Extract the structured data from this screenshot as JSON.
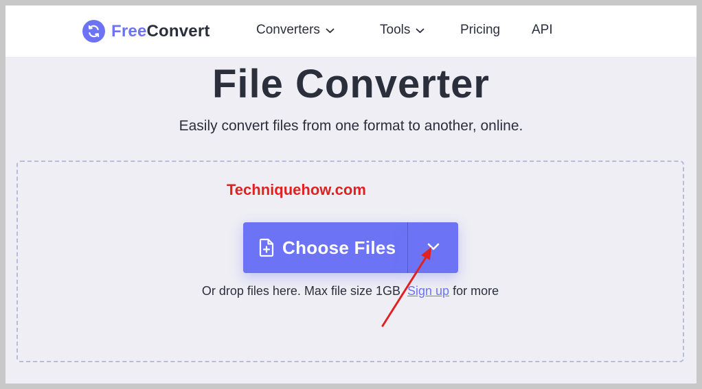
{
  "brand": {
    "name_part1": "Free",
    "name_part2": "Convert"
  },
  "nav": {
    "converters": "Converters",
    "tools": "Tools",
    "pricing": "Pricing",
    "api": "API"
  },
  "hero": {
    "title": "File Converter",
    "subtitle": "Easily convert files from one format to another, online."
  },
  "upload": {
    "watermark": "Techniquehow.com",
    "choose_label": "Choose Files",
    "hint_prefix": "Or drop files here. Max file size 1GB.",
    "hint_link": "Sign up",
    "hint_suffix": "for more"
  },
  "colors": {
    "accent": "#6c74f5",
    "text": "#2b2f3c",
    "watermark": "#e02121",
    "dropzone_bg": "#eeeef4"
  },
  "icons": {
    "logo": "refresh-circle-icon",
    "nav_chevron": "chevron-down-icon",
    "file_add": "file-plus-icon",
    "dropdown": "chevron-down-icon",
    "annotation": "red-arrow"
  }
}
